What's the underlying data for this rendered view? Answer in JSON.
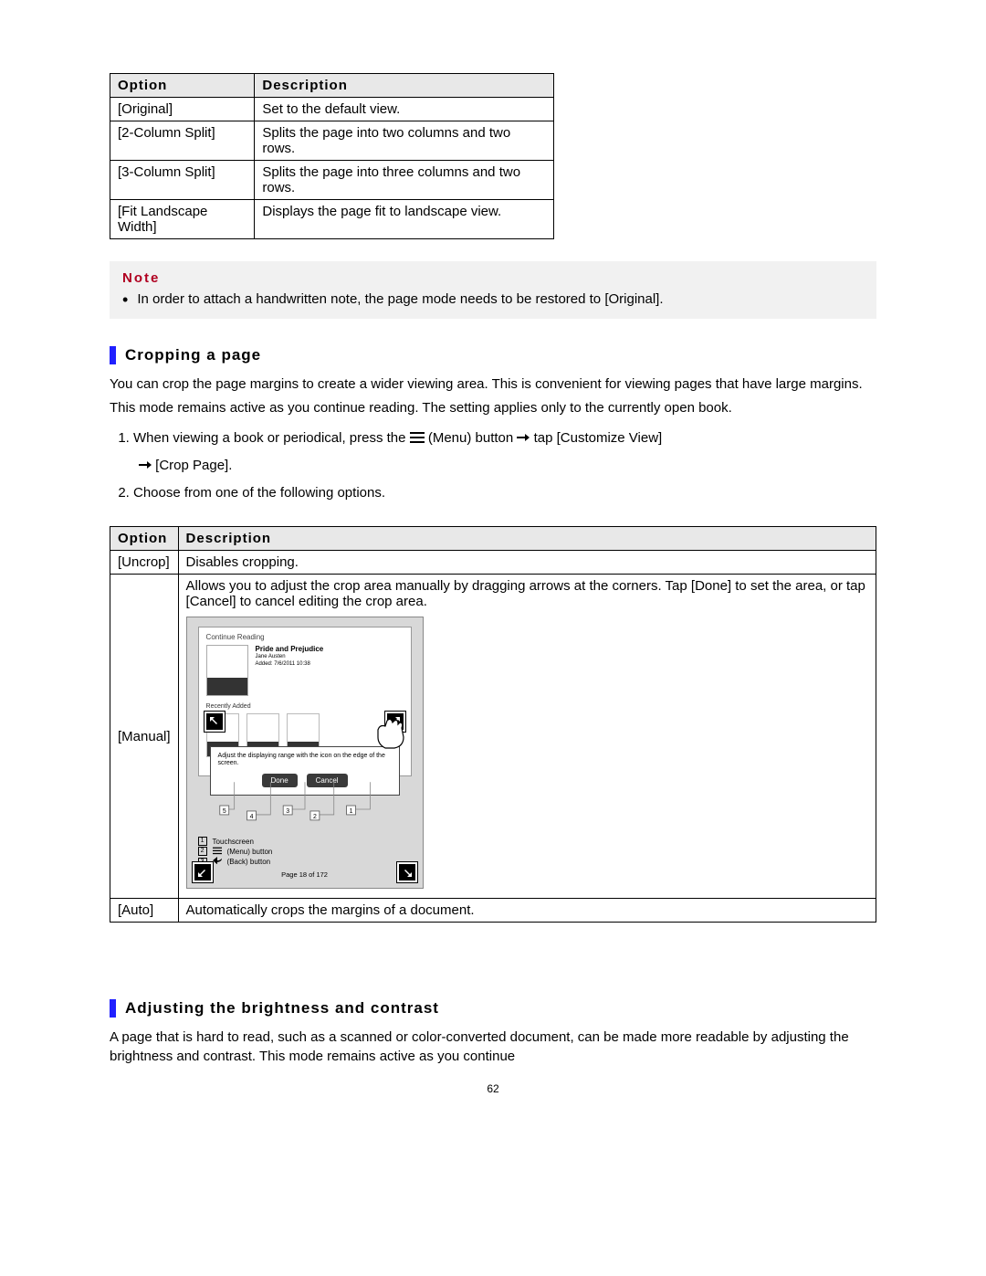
{
  "table1": {
    "headers": {
      "opt": "Option",
      "desc": "Description"
    },
    "rows": [
      {
        "opt": "[Original]",
        "desc": "Set to the default view."
      },
      {
        "opt": "[2-Column Split]",
        "desc": "Splits the page into two columns and two rows."
      },
      {
        "opt": "[3-Column Split]",
        "desc": "Splits the page into three columns and two rows."
      },
      {
        "opt": "[Fit Landscape Width]",
        "desc": "Displays the page fit to landscape view."
      }
    ]
  },
  "note": {
    "title": "Note",
    "text": "In order to attach a handwritten note, the page mode needs to be restored to [Original]."
  },
  "section1": {
    "title": "Cropping a page",
    "p1": "You can crop the page margins to create a wider viewing area. This is convenient for viewing pages that have large margins.",
    "p2": "This mode remains active as you continue reading. The setting applies only to the currently open book.",
    "step1_a": "When viewing a book or periodical, press the ",
    "step1_b": " (Menu) button ",
    "step1_c": " tap [Customize View] ",
    "step1_d": " [Crop Page].",
    "step2": "Choose from one of the following options."
  },
  "table2": {
    "headers": {
      "opt": "Option",
      "desc": "Description"
    },
    "rows": {
      "uncrop": {
        "opt": "[Uncrop]",
        "desc": "Disables cropping."
      },
      "manual": {
        "opt": "[Manual]",
        "desc": "Allows you to adjust the crop area manually by dragging arrows at the corners. Tap [Done] to set the area, or tap [Cancel] to cancel editing the crop area."
      },
      "auto": {
        "opt": "[Auto]",
        "desc": "Automatically crops the margins of a document."
      }
    }
  },
  "screenshot": {
    "section_label": "Continue Reading",
    "book_title": "Pride and Prejudice",
    "book_author": "Jane Austen",
    "book_date": "Added: 7/6/2011 10:38",
    "sub_label": "Recently Added",
    "dialog_text": "Adjust the displaying range with the icon on the edge of the screen.",
    "done": "Done",
    "cancel": "Cancel",
    "legend": [
      {
        "n": "1",
        "label": "Touchscreen"
      },
      {
        "n": "2",
        "label": "(Menu) button",
        "icon": "menu"
      },
      {
        "n": "3",
        "label": "(Back) button",
        "icon": "back"
      }
    ],
    "page_indicator": "Page 18 of 172"
  },
  "section2": {
    "title": "Adjusting the brightness and contrast",
    "p1": "A page that is hard to read, such as a scanned or color-converted document, can be made more readable by adjusting the brightness and contrast. This mode remains active as you continue"
  },
  "page_number": "62"
}
